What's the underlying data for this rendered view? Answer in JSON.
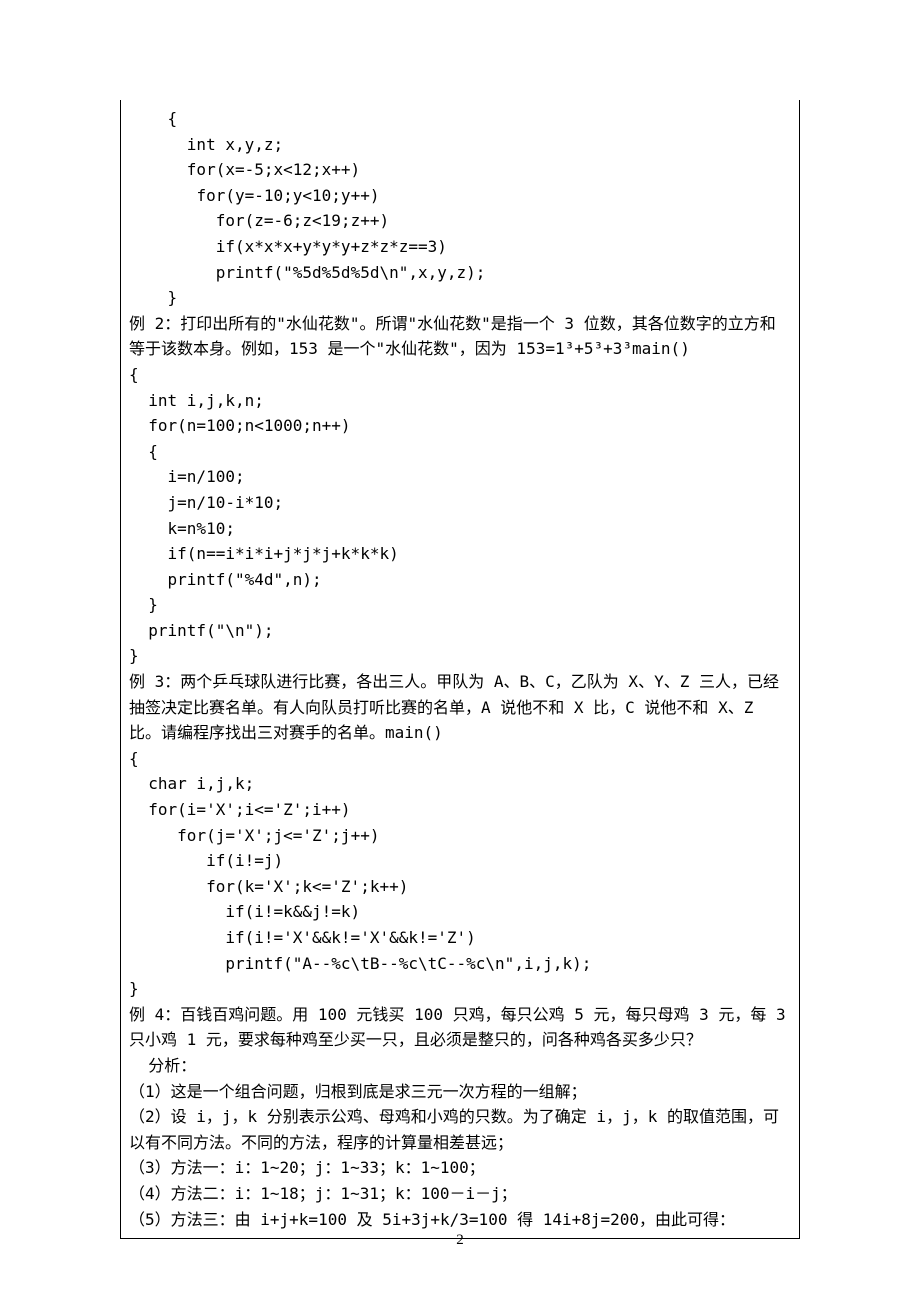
{
  "lines": [
    "    {",
    "      int x,y,z;",
    "      for(x=-5;x<12;x++)",
    "       for(y=-10;y<10;y++)",
    "         for(z=-6;z<19;z++)",
    "         if(x*x*x+y*y*y+z*z*z==3)",
    "         printf(\"%5d%5d%5d\\n\",x,y,z);",
    "    }",
    "例 2：打印出所有的\"水仙花数\"。所谓\"水仙花数\"是指一个 3 位数，其各位数字的立方和等于该数本身。例如，153 是一个\"水仙花数\"，因为 153=1³+5³+3³main()",
    "{",
    "  int i,j,k,n;",
    "  for(n=100;n<1000;n++)",
    "  {",
    "    i=n/100;",
    "    j=n/10-i*10;",
    "    k=n%10;",
    "    if(n==i*i*i+j*j*j+k*k*k)",
    "    printf(\"%4d\",n);",
    "  }",
    "  printf(\"\\n\");",
    "}",
    "例 3：两个乒乓球队进行比赛，各出三人。甲队为 A、B、C，乙队为 X、Y、Z 三人，已经抽签决定比赛名单。有人向队员打听比赛的名单，A 说他不和 X 比，C 说他不和 X、Z 比。请编程序找出三对赛手的名单。main()",
    "{",
    "  char i,j,k;",
    "  for(i='X';i<='Z';i++)",
    "     for(j='X';j<='Z';j++)",
    "        if(i!=j)",
    "        for(k='X';k<='Z';k++)",
    "          if(i!=k&&j!=k)",
    "          if(i!='X'&&k!='X'&&k!='Z')",
    "          printf(\"A--%c\\tB--%c\\tC--%c\\n\",i,j,k);",
    "}",
    "例 4：百钱百鸡问题。用 100 元钱买 100 只鸡，每只公鸡 5 元，每只母鸡 3 元，每 3 只小鸡 1 元，要求每种鸡至少买一只，且必须是整只的，问各种鸡各买多少只？",
    "  分析：",
    "（1）这是一个组合问题，归根到底是求三元一次方程的一组解；",
    "（2）设 i，j，k 分别表示公鸡、母鸡和小鸡的只数。为了确定 i，j，k 的取值范围，可以有不同方法。不同的方法，程序的计算量相差甚远；",
    "（3）方法一：i：1~20；j：1~33；k：1~100；",
    "（4）方法二：i：1~18；j：1~31；k：100－i－j；",
    "（5）方法三：由 i+j+k=100 及 5i+3j+k/3=100 得 14i+8j=200，由此可得："
  ],
  "pageNumber": "2"
}
